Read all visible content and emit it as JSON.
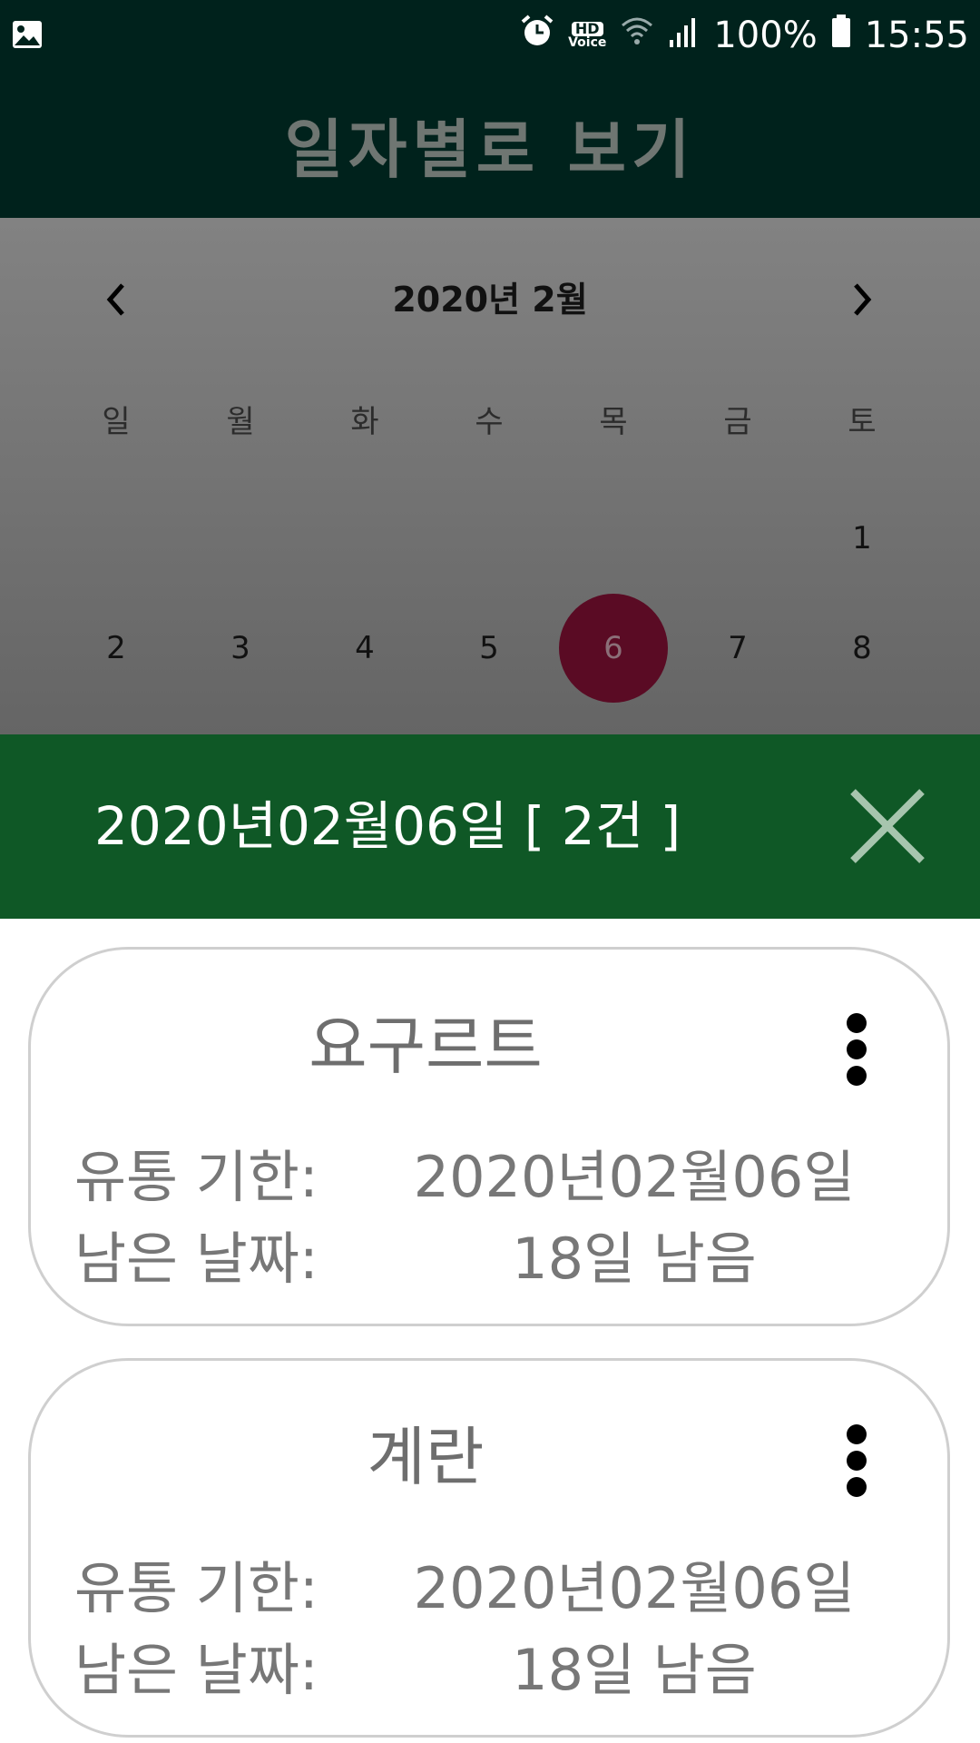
{
  "status_bar": {
    "battery": "100%",
    "time": "15:55",
    "hd_label": "HD",
    "voice_label": "Voice"
  },
  "app_bar": {
    "title": "일자별로 보기"
  },
  "calendar": {
    "month_label": "2020년 2월",
    "weekdays": [
      "일",
      "월",
      "화",
      "수",
      "목",
      "금",
      "토"
    ],
    "row1": [
      "1"
    ],
    "row2": [
      "2",
      "3",
      "4",
      "5",
      "6",
      "7",
      "8"
    ],
    "selected_day": "6",
    "selected_color": "#5a0b24"
  },
  "day_header": {
    "title": "2020년02월06일 [ 2건 ]",
    "background": "#0f5826"
  },
  "items": [
    {
      "name": "요구르트",
      "expiry_label": "유통 기한:",
      "expiry_value": "2020년02월06일",
      "remaining_label": "남은 날짜:",
      "remaining_value": "18일 남음"
    },
    {
      "name": "계란",
      "expiry_label": "유통 기한:",
      "expiry_value": "2020년02월06일",
      "remaining_label": "남은 날짜:",
      "remaining_value": "18일 남음"
    }
  ]
}
